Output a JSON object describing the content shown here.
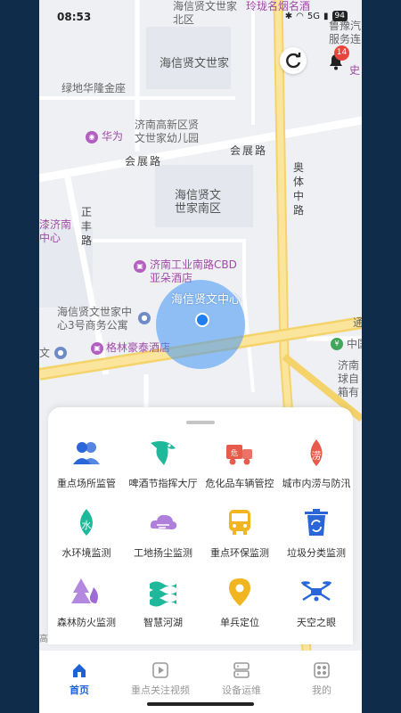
{
  "status_bar": {
    "time": "08:53",
    "battery": "94",
    "signal": "5G"
  },
  "map": {
    "labels": {
      "top_block": "海信贤文世家北区",
      "top_block2": "海信贤文世家",
      "lvdi": "绿地华隆金座",
      "huawei": "华为",
      "kindergarten": "济南高新区贤\n文世家幼儿园",
      "huizhan_road1": "会展路",
      "huizhan_road2": "会展路",
      "aoti_road": "奥体中路",
      "zhengfeng_road": "正丰路",
      "south_block": "海信贤文\n世家南区",
      "qianji": "漆济南\n中心",
      "hotel_cbd": "济南工业南路CBD\n亚朵酒店",
      "center": "海信贤文中心",
      "business": "海信贤文世家中\n心3号商务公寓",
      "gelin": "格林豪泰酒店",
      "linglong": "玲珑名烟名酒",
      "service": "服务连",
      "bank": "中国",
      "jinan_right": "济南\n球自\n箱有",
      "baiwei": "鲁豫汽",
      "xun": "通",
      "wen": "文",
      "shi": "史"
    },
    "notification_count": "14"
  },
  "modules": [
    {
      "label": "重点场所监管",
      "icon": "people-icon",
      "color": "#2a66d8"
    },
    {
      "label": "啤酒节指挥大厅",
      "icon": "eagle-icon",
      "color": "#1fb89a"
    },
    {
      "label": "危化品车辆管控",
      "icon": "hazard-truck-icon",
      "color": "#e85a4a"
    },
    {
      "label": "城市内涝与防汛",
      "icon": "flood-drop-icon",
      "color": "#e85a4a"
    },
    {
      "label": "水环境监测",
      "icon": "water-drop-icon",
      "color": "#1fb89a"
    },
    {
      "label": "工地扬尘监测",
      "icon": "dust-cloud-icon",
      "color": "#a06ad6"
    },
    {
      "label": "重点环保监测",
      "icon": "bus-icon",
      "color": "#f0b521"
    },
    {
      "label": "垃圾分类监测",
      "icon": "recycle-bin-icon",
      "color": "#2a66d8"
    },
    {
      "label": "森林防火监测",
      "icon": "forest-fire-icon",
      "color": "#a06ad6"
    },
    {
      "label": "智慧河湖",
      "icon": "waves-icon",
      "color": "#1fb89a"
    },
    {
      "label": "单兵定位",
      "icon": "location-pin-icon",
      "color": "#f0b521"
    },
    {
      "label": "天空之眼",
      "icon": "drone-icon",
      "color": "#2a66d8"
    }
  ],
  "tabs": [
    {
      "label": "首页",
      "icon": "home-icon",
      "active": true
    },
    {
      "label": "重点关注视频",
      "icon": "video-icon",
      "active": false
    },
    {
      "label": "设备运维",
      "icon": "device-icon",
      "active": false
    },
    {
      "label": "我的",
      "icon": "profile-icon",
      "active": false
    }
  ],
  "watermark": "高德地图"
}
